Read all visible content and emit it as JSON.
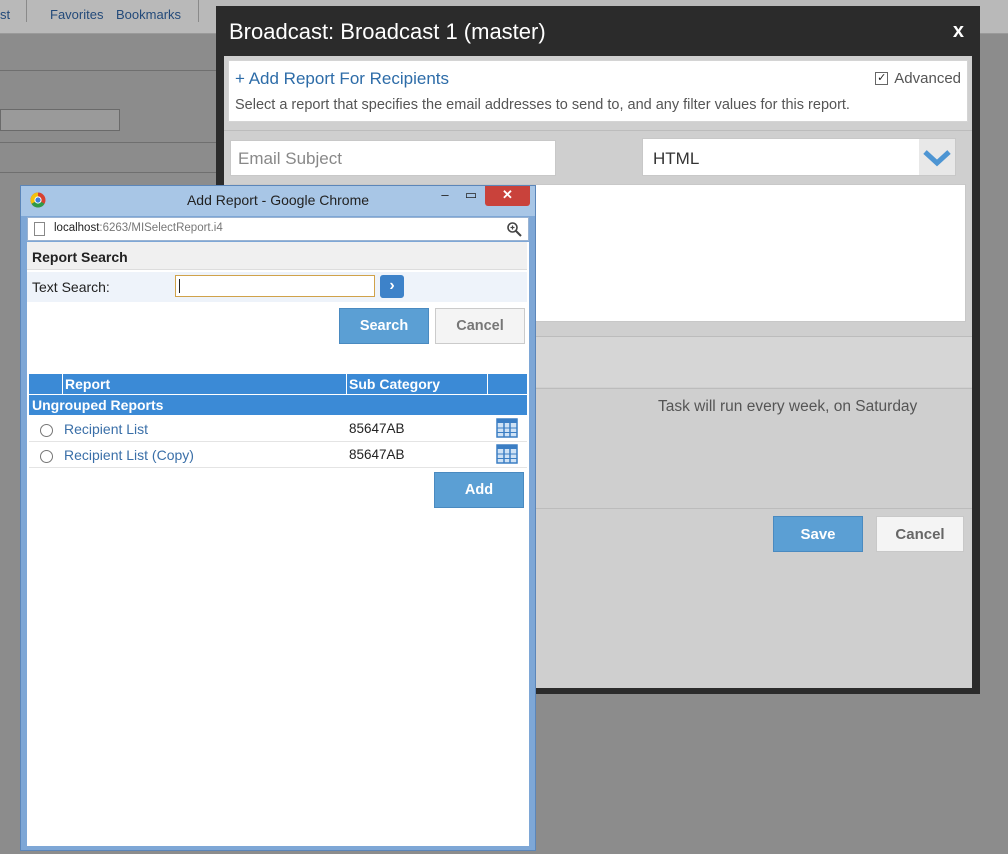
{
  "background": {
    "toolbar_items": [
      "st",
      "Favorites",
      "Bookmarks"
    ]
  },
  "broadcast": {
    "title": "Broadcast: Broadcast 1 (master)",
    "close_label": "x",
    "add_recipients_label": "+ Add Report For Recipients",
    "recipients_description": "Select a report that specifies the email addresses to send to, and any filter values for this report.",
    "advanced_label": "Advanced",
    "advanced_checked": true,
    "email_subject_placeholder": "Email Subject",
    "format_value": "HTML",
    "schedule_message": "Task will run every week, on Saturday",
    "save_label": "Save",
    "cancel_label": "Cancel"
  },
  "popup": {
    "window_title": "Add Report - Google Chrome",
    "url_host": "localhost",
    "url_rest": ":6263/MISelectReport.i4",
    "section_title": "Report Search",
    "text_search_label": "Text Search:",
    "text_search_value": "",
    "search_label": "Search",
    "cancel_label": "Cancel",
    "table": {
      "columns": [
        "Report",
        "Sub Category"
      ],
      "group": "Ungrouped Reports",
      "rows": [
        {
          "name": "Recipient List",
          "sub_category": "85647AB"
        },
        {
          "name": "Recipient List (Copy)",
          "sub_category": "85647AB"
        }
      ]
    },
    "add_label": "Add"
  }
}
